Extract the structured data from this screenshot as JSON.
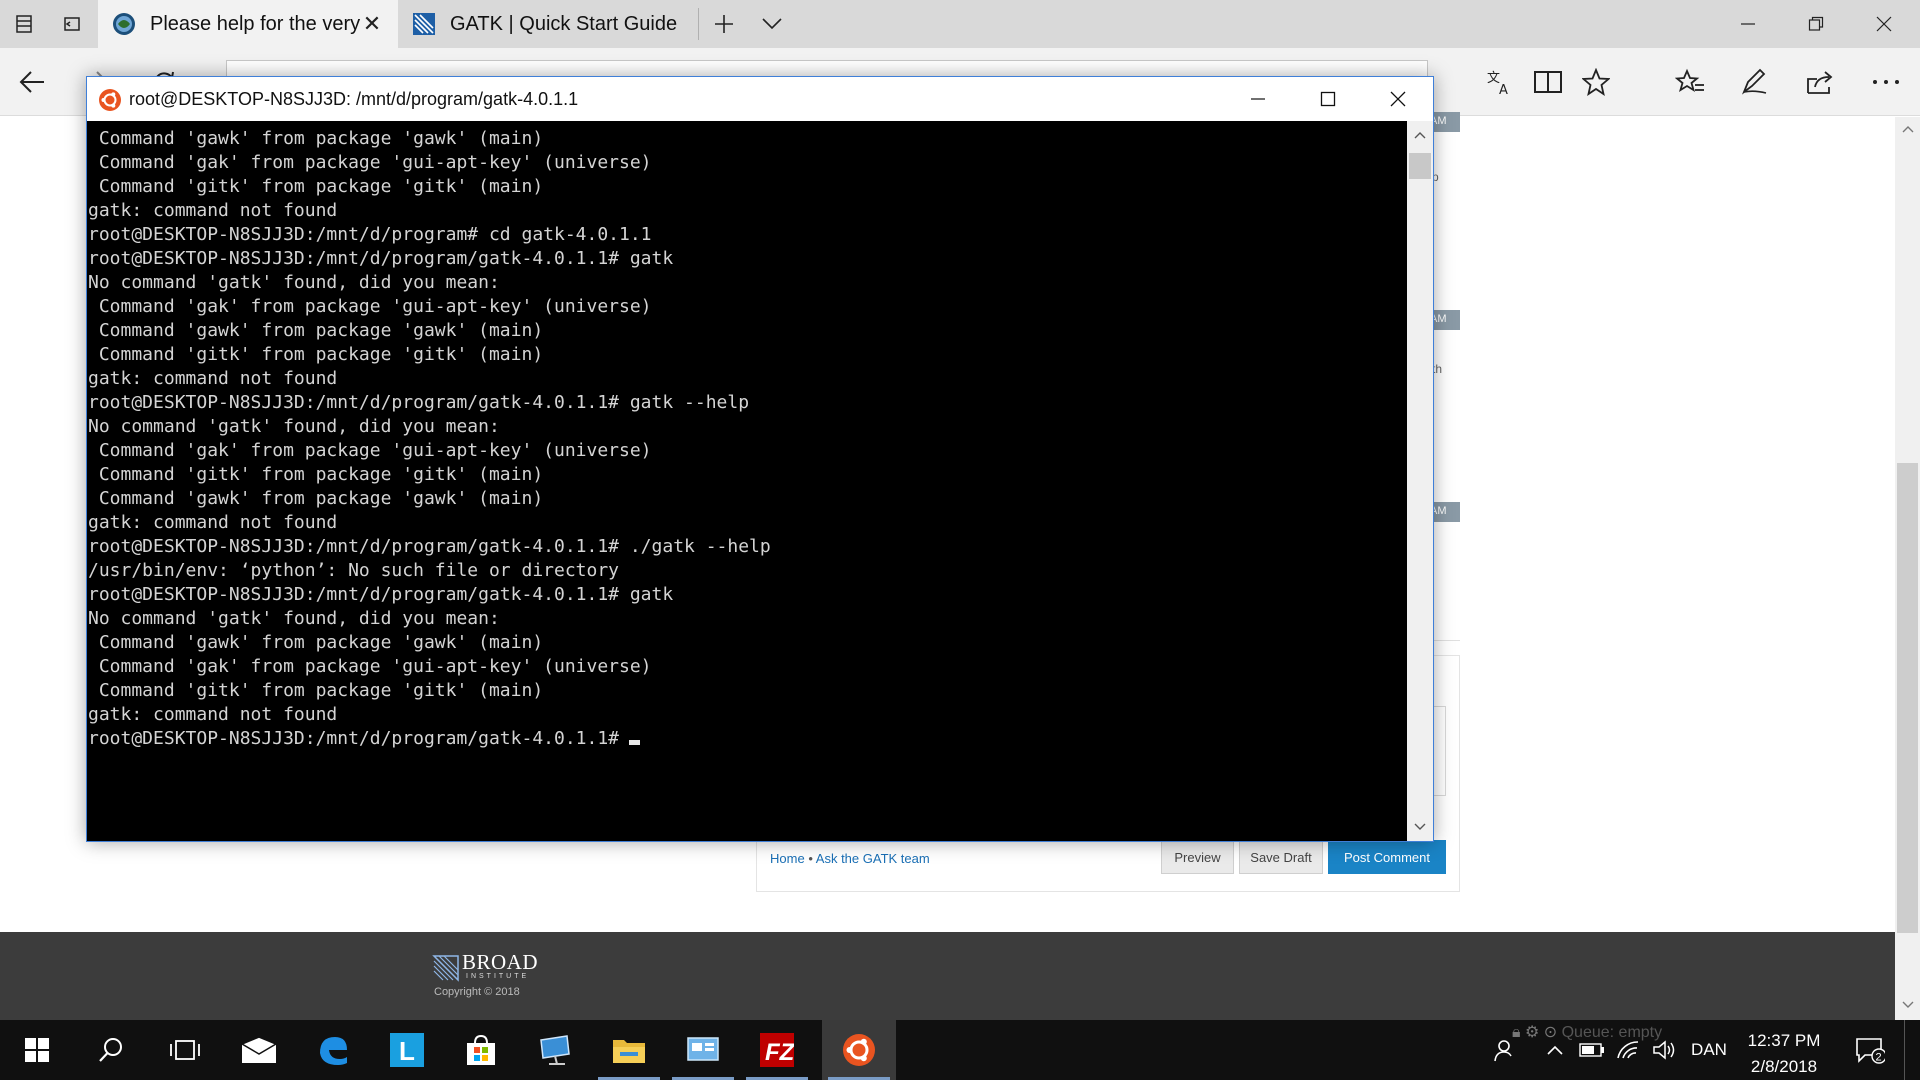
{
  "browser": {
    "tabs": [
      {
        "label": "Please help for the very",
        "active": true,
        "icon": "globe-icon"
      },
      {
        "label": "GATK | Quick Start Guide",
        "active": false,
        "icon": "gatk-icon"
      }
    ],
    "address_text": "                                                                         "
  },
  "webpage": {
    "timestamps": [
      "AM",
      "AM",
      "AM"
    ],
    "side_fragments": [
      "p",
      "th"
    ],
    "breadcrumb": {
      "home": "Home",
      "separator": "•",
      "section": "Ask the GATK team"
    },
    "buttons": {
      "preview": "Preview",
      "save_draft": "Save Draft",
      "post_comment": "Post Comment"
    },
    "footer": {
      "logo_name": "BROAD",
      "logo_sub": "INSTITUTE",
      "copyright": "Copyright © 2018"
    }
  },
  "terminal": {
    "title": "root@DESKTOP-N8SJJ3D: /mnt/d/program/gatk-4.0.1.1",
    "lines": [
      " Command 'gawk' from package 'gawk' (main)",
      " Command 'gak' from package 'gui-apt-key' (universe)",
      " Command 'gitk' from package 'gitk' (main)",
      "gatk: command not found",
      "root@DESKTOP-N8SJJ3D:/mnt/d/program# cd gatk-4.0.1.1",
      "root@DESKTOP-N8SJJ3D:/mnt/d/program/gatk-4.0.1.1# gatk",
      "No command 'gatk' found, did you mean:",
      " Command 'gak' from package 'gui-apt-key' (universe)",
      " Command 'gawk' from package 'gawk' (main)",
      " Command 'gitk' from package 'gitk' (main)",
      "gatk: command not found",
      "root@DESKTOP-N8SJJ3D:/mnt/d/program/gatk-4.0.1.1# gatk --help",
      "No command 'gatk' found, did you mean:",
      " Command 'gak' from package 'gui-apt-key' (universe)",
      " Command 'gitk' from package 'gitk' (main)",
      " Command 'gawk' from package 'gawk' (main)",
      "gatk: command not found",
      "root@DESKTOP-N8SJJ3D:/mnt/d/program/gatk-4.0.1.1# ./gatk --help",
      "/usr/bin/env: ‘python’: No such file or directory",
      "root@DESKTOP-N8SJJ3D:/mnt/d/program/gatk-4.0.1.1# gatk",
      "No command 'gatk' found, did you mean:",
      " Command 'gawk' from package 'gawk' (main)",
      " Command 'gak' from package 'gui-apt-key' (universe)",
      " Command 'gitk' from package 'gitk' (main)",
      "gatk: command not found"
    ],
    "prompt": "root@DESKTOP-N8SJJ3D:/mnt/d/program/gatk-4.0.1.1#"
  },
  "taskbar": {
    "apps": [
      "start-button",
      "search",
      "task-view",
      "mail",
      "edge",
      "lync",
      "store",
      "device",
      "file-explorer",
      "control-panel",
      "filezilla",
      "ubuntu"
    ],
    "queue_text": "Queue: empty",
    "language": "DAN",
    "time": "12:37 PM",
    "date": "2/8/2018",
    "notification_count": "2"
  },
  "colors": {
    "terminal_bg": "#000000",
    "terminal_text": "#d4d4d4",
    "ubuntu_orange": "#e95420",
    "taskbar_bg": "#101010",
    "post_button": "#1a84c6",
    "footer_bg": "#3c3c3c"
  }
}
